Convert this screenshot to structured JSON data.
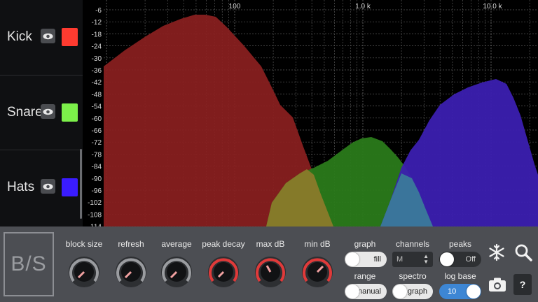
{
  "tracks": [
    {
      "name": "Kick",
      "color": "#ff3b30"
    },
    {
      "name": "Snare",
      "color": "#7cf04a"
    },
    {
      "name": "Hats",
      "color": "#3a1cff"
    }
  ],
  "icons": {
    "visibility": "eye-icon",
    "settings": "snowflake-icon",
    "zoom": "search-icon",
    "capture": "camera-icon"
  },
  "spectrum": {
    "y_labels": [
      "-6",
      "-12",
      "-18",
      "-24",
      "-30",
      "-36",
      "-42",
      "-48",
      "-54",
      "-60",
      "-66",
      "-72",
      "-78",
      "-84",
      "-90",
      "-96",
      "-102",
      "-108",
      "-114"
    ],
    "x_labels": [
      "100",
      "1.0 k",
      "10.0 k"
    ],
    "colors": {
      "kick": "#8b1f1f",
      "snare": "#2a7a1a",
      "hats": "#3b1fb0",
      "overlap_kick_snare": "#8a7a2a",
      "overlap_snare_hats": "#3a7a9a"
    }
  },
  "logo": {
    "text": "B/S"
  },
  "knobs": [
    {
      "label": "block size",
      "accent": "#9a9ca0"
    },
    {
      "label": "refresh",
      "accent": "#9a9ca0"
    },
    {
      "label": "average",
      "accent": "#9a9ca0"
    },
    {
      "label": "peak decay",
      "accent": "#e03a3a"
    },
    {
      "label": "max dB",
      "accent": "#e03a3a"
    },
    {
      "label": "min dB",
      "accent": "#e03a3a"
    }
  ],
  "switches": {
    "graph": {
      "label": "graph",
      "value": "fill"
    },
    "channels": {
      "label": "channels",
      "value": "M"
    },
    "peaks": {
      "label": "peaks",
      "value": "Off"
    },
    "range": {
      "label": "range",
      "value": "manual"
    },
    "spectro": {
      "label": "spectro",
      "value": "graph"
    },
    "log_base": {
      "label": "log base",
      "value": "10"
    }
  },
  "help": {
    "label": "?"
  }
}
